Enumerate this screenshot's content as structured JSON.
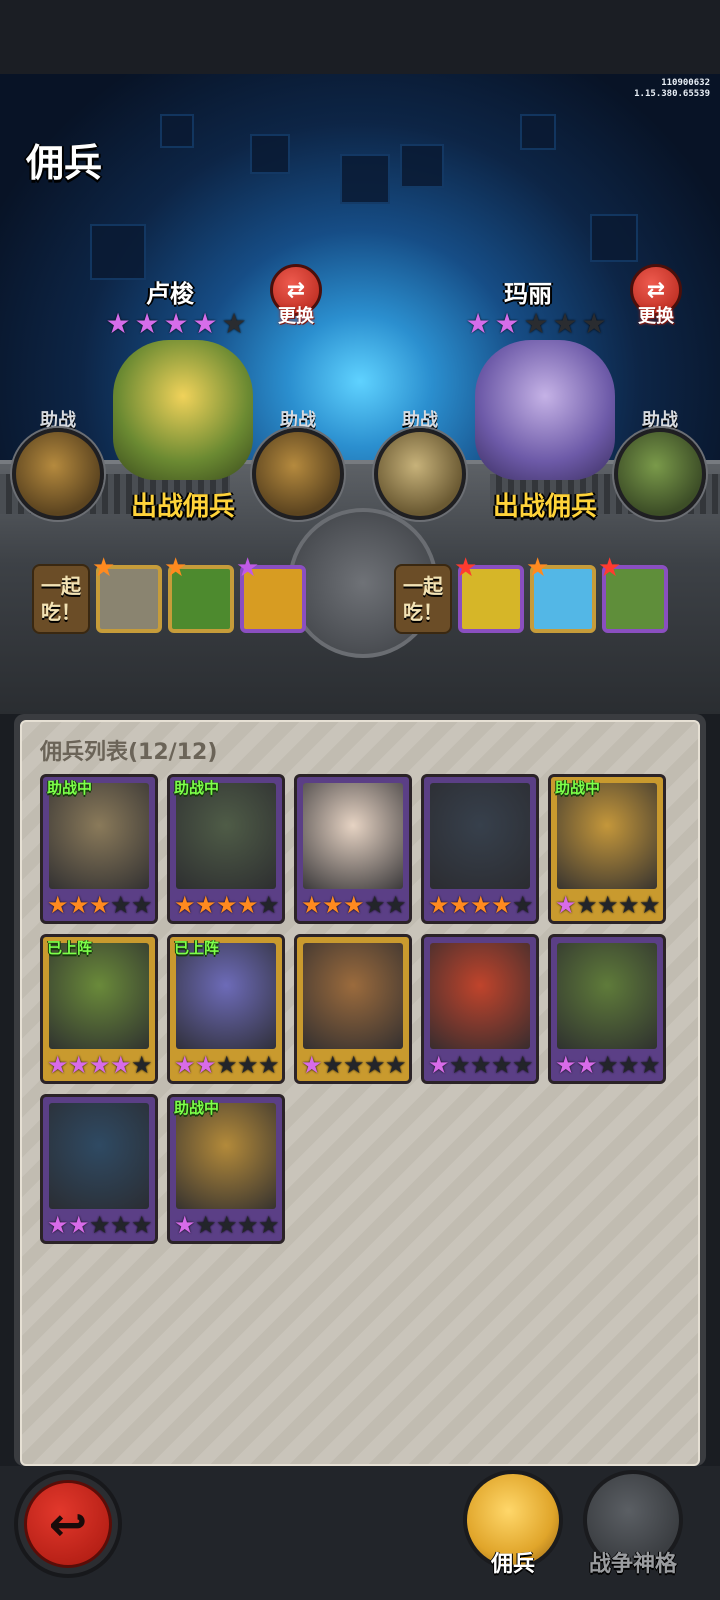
{
  "page_title": "佣兵",
  "version": {
    "line1": "110900632",
    "line2": "1.15.380.65539"
  },
  "team_left": {
    "hero_name": "卢梭",
    "stars": 4,
    "max_stars": 5,
    "swap_label": "更换",
    "deploy_label": "出战佣兵",
    "helper_left_label": "助战",
    "helper_right_label": "助战",
    "eat_label": "一起吃！",
    "food_star_colors": [
      "#ff8a1f",
      "#ff8a1f",
      "#c05ae6"
    ]
  },
  "team_right": {
    "hero_name": "玛丽",
    "stars": 2,
    "max_stars": 5,
    "swap_label": "更换",
    "deploy_label": "出战佣兵",
    "helper_left_label": "助战",
    "helper_right_label": "助战",
    "eat_label": "一起吃！",
    "food_star_colors": [
      "#ff3b2f",
      "#ff8a1f",
      "#ff3b2f"
    ]
  },
  "list": {
    "title": "佣兵列表(12/12)",
    "cards": [
      {
        "tag": "助战中",
        "stars": 3,
        "star_color": "orange",
        "frame": "purple",
        "art": "#8a7a5a"
      },
      {
        "tag": "助战中",
        "stars": 4,
        "star_color": "orange",
        "frame": "purple",
        "art": "#4f5c47"
      },
      {
        "tag": "",
        "stars": 3,
        "star_color": "orange",
        "frame": "purple",
        "art": "#e6d3c3"
      },
      {
        "tag": "",
        "stars": 4,
        "star_color": "orange",
        "frame": "purple",
        "art": "#37404c"
      },
      {
        "tag": "助战中",
        "stars": 1,
        "star_color": "pink",
        "frame": "gold",
        "art": "#c4973b"
      },
      {
        "tag": "已上阵",
        "stars": 4,
        "star_color": "pink",
        "frame": "gold",
        "art": "#6a8a3a"
      },
      {
        "tag": "已上阵",
        "stars": 2,
        "star_color": "pink",
        "frame": "gold",
        "art": "#6d6bb8"
      },
      {
        "tag": "",
        "stars": 1,
        "star_color": "pink",
        "frame": "gold",
        "art": "#9b6b3d"
      },
      {
        "tag": "",
        "stars": 1,
        "star_color": "pink",
        "frame": "purple",
        "art": "#c0442c"
      },
      {
        "tag": "",
        "stars": 2,
        "star_color": "pink",
        "frame": "purple",
        "art": "#5f7b3a"
      },
      {
        "tag": "",
        "stars": 2,
        "star_color": "pink",
        "frame": "purple",
        "art": "#2f4a63"
      },
      {
        "tag": "助战中",
        "stars": 1,
        "star_color": "pink",
        "frame": "purple",
        "art": "#b38a3a"
      }
    ]
  },
  "bottom_nav": {
    "back_icon": "back-arrow-icon",
    "tab_mercenary": "佣兵",
    "tab_war_deity": "战争神格"
  }
}
